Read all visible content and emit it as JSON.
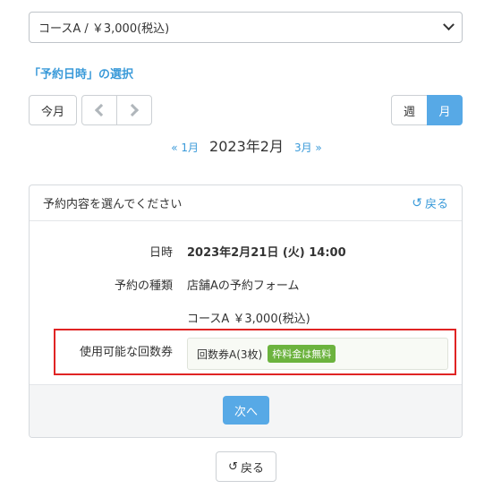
{
  "course_select": {
    "value": "コースA / ￥3,000(税込)"
  },
  "section_title": "「予約日時」の選択",
  "toolbar": {
    "today_label": "今月",
    "week_label": "週",
    "month_label": "月"
  },
  "month_nav": {
    "prev_label": "« 1月",
    "current": "2023年2月",
    "next_label": "3月 »"
  },
  "panel": {
    "header_title": "予約内容を選んでください",
    "back_label": "戻る",
    "rows": {
      "datetime_label": "日時",
      "datetime_value": "2023年2月21日 (火) 14:00",
      "type_label": "予約の種類",
      "type_value": "店舗Aの予約フォーム",
      "course_value": "コースA ￥3,000(税込)",
      "ticket_label": "使用可能な回数券",
      "ticket_value": "回数券A(3枚)",
      "ticket_badge": "枠料金は無料"
    },
    "next_label": "次へ"
  },
  "bottom_back_label": "戻る",
  "colors": {
    "accent": "#57a9e6",
    "link": "#3a9ad9",
    "badge": "#6cb33e",
    "highlight": "#e02424"
  },
  "icons": {
    "undo": "undo-icon",
    "chevron": "chevron-down-icon"
  }
}
